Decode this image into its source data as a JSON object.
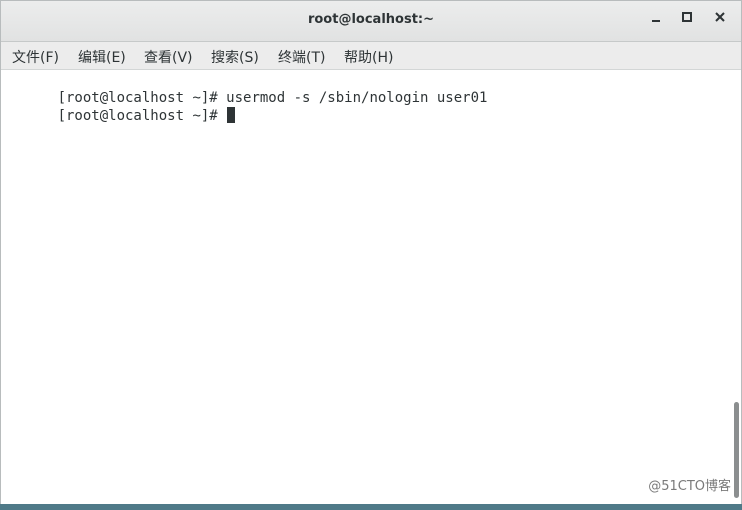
{
  "window": {
    "title": "root@localhost:~"
  },
  "menubar": {
    "items": [
      {
        "label": "文件(F)"
      },
      {
        "label": "编辑(E)"
      },
      {
        "label": "查看(V)"
      },
      {
        "label": "搜索(S)"
      },
      {
        "label": "终端(T)"
      },
      {
        "label": "帮助(H)"
      }
    ]
  },
  "terminal": {
    "lines": [
      {
        "text": "[root@localhost ~]# usermod -s /sbin/nologin user01"
      },
      {
        "text": "[root@localhost ~]# "
      }
    ]
  },
  "watermark": "@51CTO博客",
  "icons": {
    "minimize": "minimize-icon",
    "maximize": "maximize-icon",
    "close": "close-icon"
  }
}
